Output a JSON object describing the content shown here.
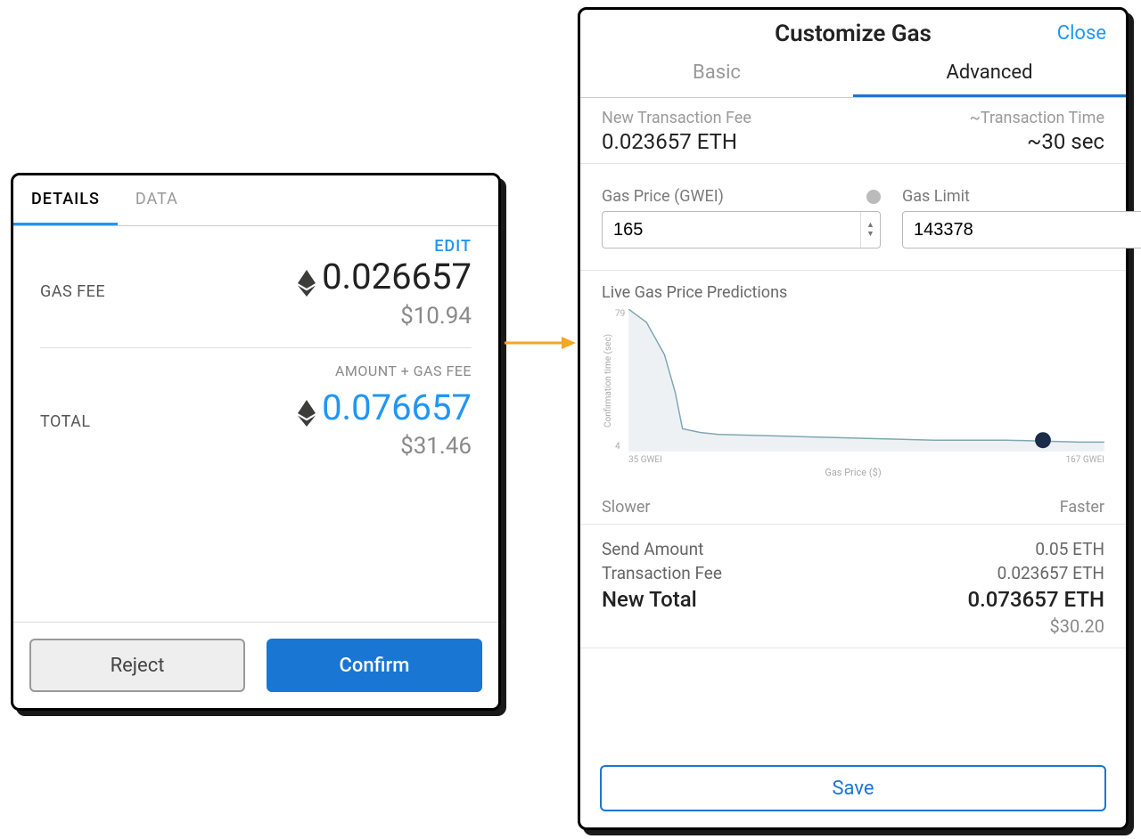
{
  "left": {
    "tabs": {
      "details": "DETAILS",
      "data": "DATA"
    },
    "edit": "EDIT",
    "gas_fee_label": "GAS FEE",
    "gas_fee_eth": "0.026657",
    "gas_fee_usd": "$10.94",
    "amount_plus": "AMOUNT + GAS FEE",
    "total_label": "TOTAL",
    "total_eth": "0.076657",
    "total_usd": "$31.46",
    "reject": "Reject",
    "confirm": "Confirm"
  },
  "right": {
    "title": "Customize Gas",
    "close": "Close",
    "tab_basic": "Basic",
    "tab_advanced": "Advanced",
    "new_fee_label": "New Transaction Fee",
    "new_fee_value": "0.023657 ETH",
    "tx_time_label": "~Transaction Time",
    "tx_time_value": "~30 sec",
    "gas_price_label": "Gas Price (GWEI)",
    "gas_price_value": "165",
    "gas_limit_label": "Gas Limit",
    "gas_limit_value": "143378",
    "chart_title": "Live Gas Price Predictions",
    "ylabel": "Confirmation time (sec)",
    "ytick_top": "79",
    "ytick_bot": "4",
    "xlabel": "Gas Price ($)",
    "xtick_left": "35 GWEI",
    "xtick_right": "167 GWEI",
    "slower": "Slower",
    "faster": "Faster",
    "send_amount_label": "Send Amount",
    "send_amount_value": "0.05 ETH",
    "tx_fee_label": "Transaction Fee",
    "tx_fee_value": "0.023657 ETH",
    "new_total_label": "New Total",
    "new_total_value": "0.073657 ETH",
    "new_total_usd": "$30.20",
    "save": "Save"
  },
  "chart_data": {
    "type": "line",
    "title": "Live Gas Price Predictions",
    "xlabel": "Gas Price ($)",
    "ylabel": "Confirmation time (sec)",
    "xlim": [
      35,
      167
    ],
    "ylim": [
      4,
      79
    ],
    "x_ticks": [
      "35 GWEI",
      "167 GWEI"
    ],
    "y_ticks": [
      4,
      79
    ],
    "series": [
      {
        "name": "Confirmation time",
        "x": [
          35,
          40,
          45,
          48,
          50,
          55,
          60,
          80,
          100,
          120,
          140,
          160,
          167
        ],
        "y": [
          79,
          72,
          55,
          35,
          16,
          14,
          13,
          12,
          11,
          10,
          10,
          9,
          9
        ]
      }
    ],
    "marker": {
      "x": 150,
      "y": 10,
      "label": "selected"
    },
    "annotations": {
      "slower": "Slower",
      "faster": "Faster"
    }
  }
}
